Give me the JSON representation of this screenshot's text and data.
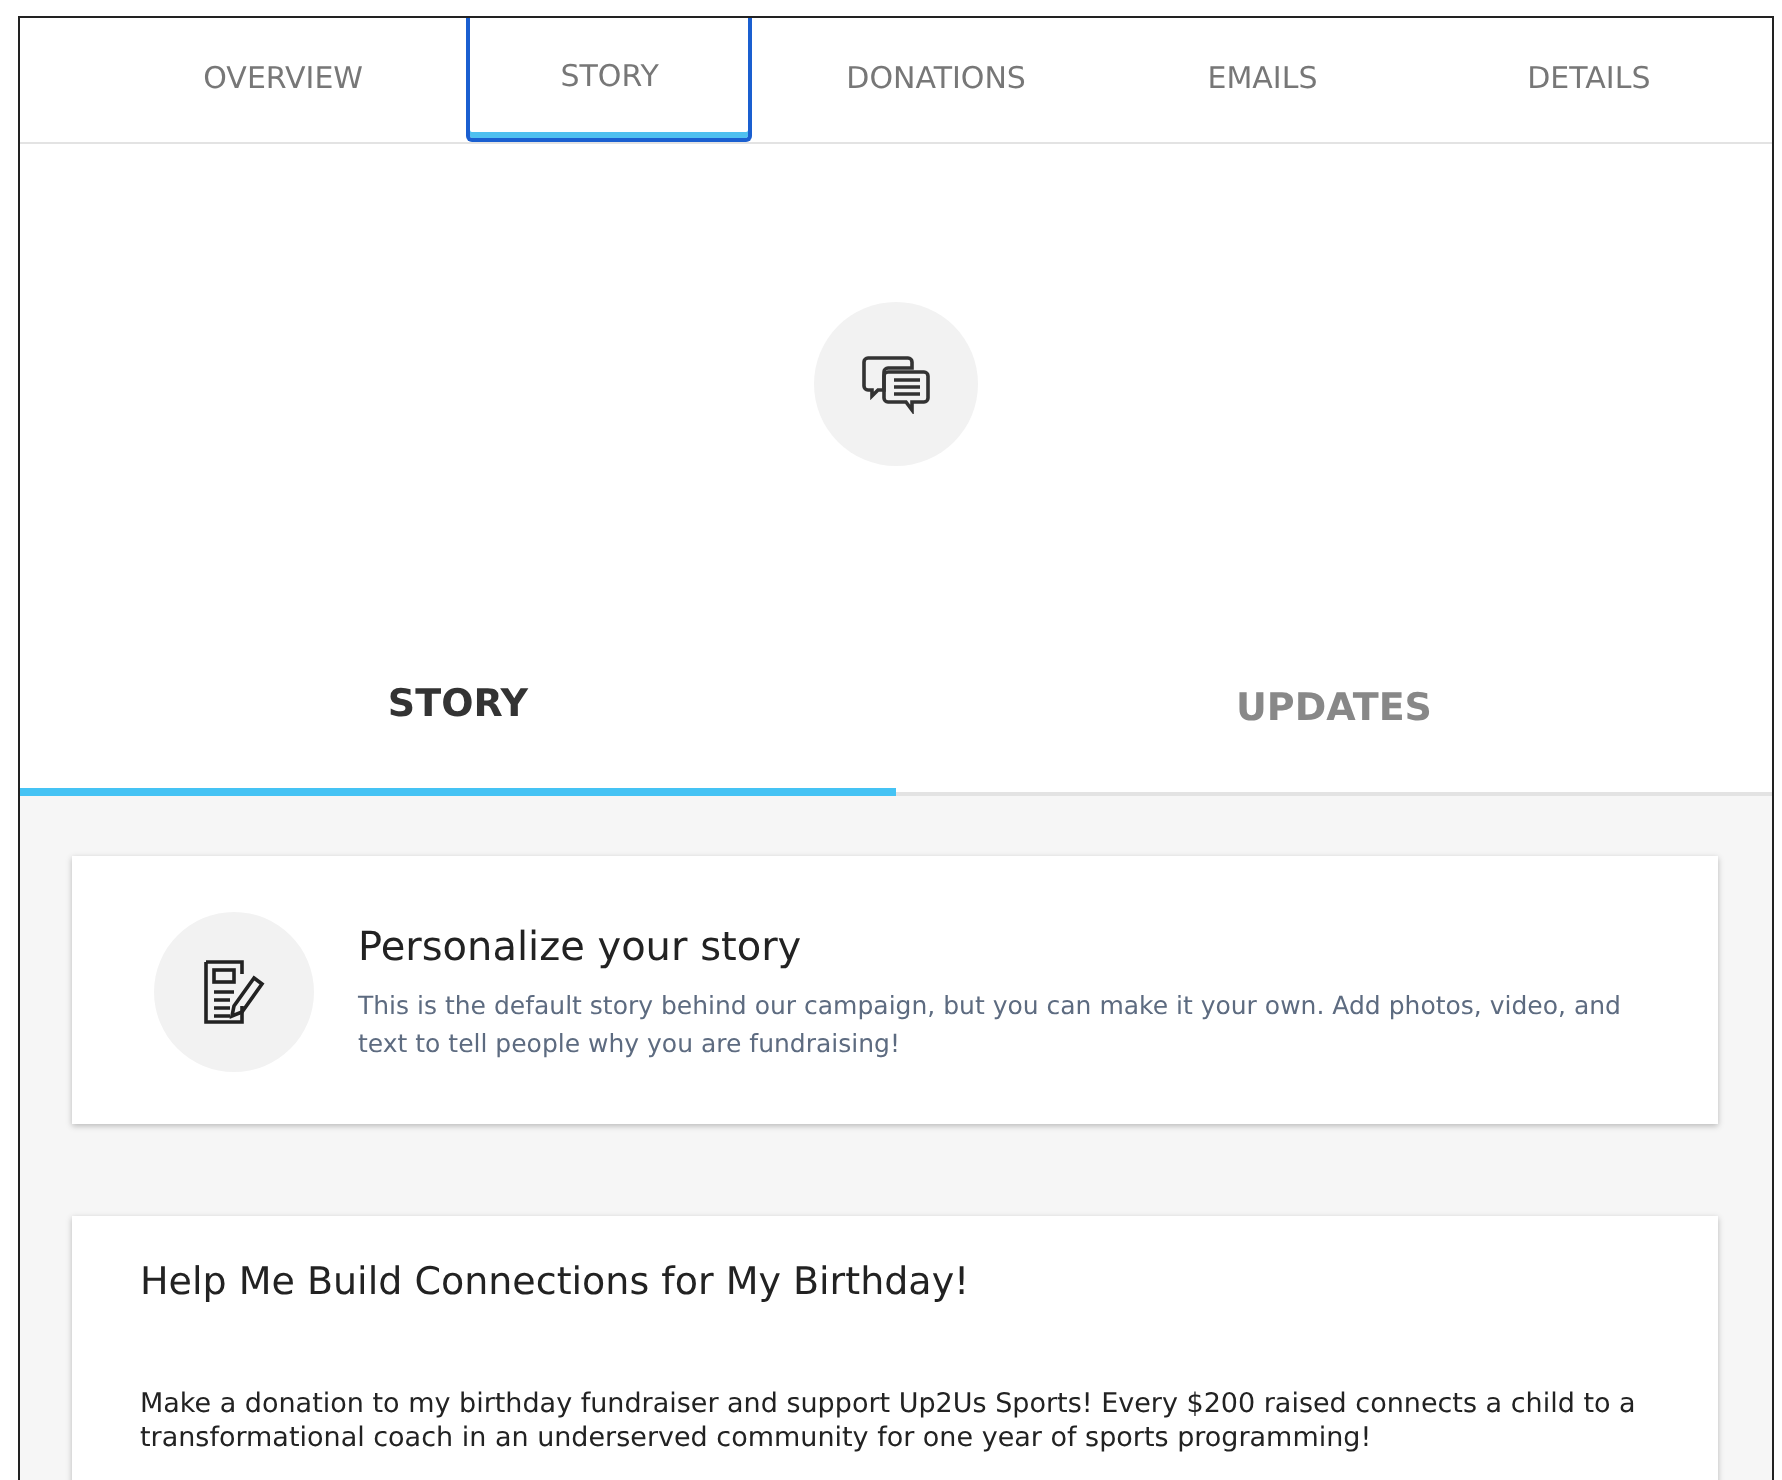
{
  "tabs": [
    {
      "label": "OVERVIEW",
      "selected": false
    },
    {
      "label": "STORY",
      "selected": true
    },
    {
      "label": "DONATIONS",
      "selected": false
    },
    {
      "label": "EMAILS",
      "selected": false
    },
    {
      "label": "DETAILS",
      "selected": false
    }
  ],
  "subtabs": [
    {
      "label": "STORY",
      "selected": true
    },
    {
      "label": "UPDATES",
      "selected": false
    }
  ],
  "tip": {
    "title": "Personalize your story",
    "text": "This is the default story behind our campaign, but you can make it your own. Add photos, video, and text to tell people why you are fundraising!"
  },
  "story": {
    "title": "Help Me Build Connections for My Birthday!",
    "text": "Make a donation to my birthday fundraiser and support Up2Us Sports! Every $200 raised connects a child to a transformational coach in an underserved community for one year of sports programming!"
  }
}
